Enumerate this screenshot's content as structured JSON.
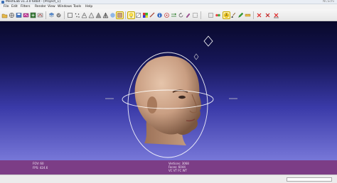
{
  "window": {
    "title": "MeshLab v1.3.0 64bit - [Project_1]",
    "brand": "NCSchi"
  },
  "menu": {
    "items": [
      "File",
      "Edit",
      "Filters",
      "Render",
      "View",
      "Windows",
      "Tools",
      "Help"
    ]
  },
  "toolbar": {
    "icons": [
      "open-project-icon",
      "open-mesh-icon",
      "save-snapshot-icon",
      "reload-icon",
      "import-icon",
      "export-icon",
      "layers-icon",
      "annotation-icon",
      "bounding-box-icon",
      "points-icon",
      "wireframe-icon",
      "hidden-lines-icon",
      "flat-shading-icon",
      "flat-lines-icon",
      "smooth-icon",
      "texture-icon",
      "lighting-icon",
      "backface-icon",
      "color-icon",
      "measure-icon",
      "info-icon",
      "pick-points-icon",
      "align-icon",
      "rotate-icon",
      "paint-icon",
      "select-icon",
      "delete-vertices-icon",
      "delete-faces-icon",
      "delete-selection-icon"
    ]
  },
  "viewport": {
    "fov_label": "FOV: 60",
    "fps_label": "FPS:  424.6",
    "vertices_label": "Vertices: 3068",
    "faces_label": "Faces: 6044",
    "mode_label": "VC VT FC WT"
  },
  "colors": {
    "background_top": "#08082a",
    "background_bottom": "#7777d8",
    "info_bar": "#7c3d86",
    "skin": "#c99e82"
  }
}
